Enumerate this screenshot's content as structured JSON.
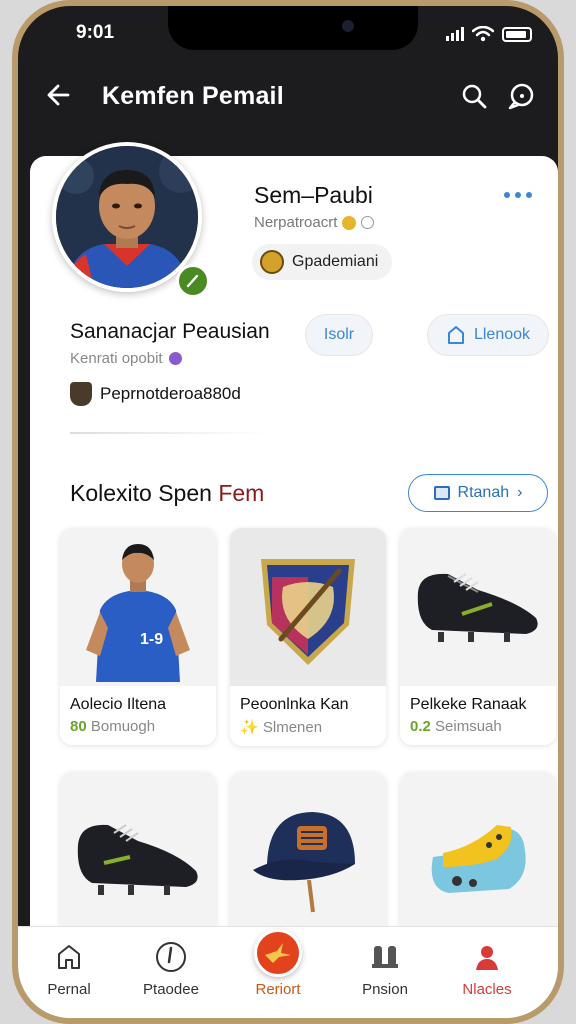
{
  "status_bar": {
    "time": "9:01"
  },
  "header": {
    "title": "Kemfen Pemail"
  },
  "profile": {
    "name": "Sem–Paubi",
    "subline": "Nerpatroacrt",
    "chip_label": "Gpademiani",
    "full_name": "Sananacjar Peausian",
    "sub2": "Kenrati opobit",
    "button_small": "Isolr",
    "button_large": "Llenook",
    "club": "Peprnotderoa880d"
  },
  "collection": {
    "title_prefix": "Kolexito Spen ",
    "title_highlight": "Fem",
    "view_all": "Rtanah",
    "items": [
      {
        "title": "Aolecio Iltena",
        "price": "80",
        "meta": "Bomuogh"
      },
      {
        "title": "Peoonlnka Kan",
        "price": "✨",
        "meta": "Slmenen"
      },
      {
        "title": "Pelkeke Ranaak",
        "price": "0.2",
        "meta": "Seimsuah"
      },
      {
        "title": "",
        "price": "",
        "meta": ""
      },
      {
        "title": "",
        "price": "",
        "meta": ""
      },
      {
        "title": "",
        "price": "",
        "meta": ""
      }
    ]
  },
  "nav": {
    "items": [
      {
        "label": "Pernal",
        "icon": "home-icon"
      },
      {
        "label": "Ptaodee",
        "icon": "compass-icon"
      },
      {
        "label": "Reriort",
        "icon": "bird-icon"
      },
      {
        "label": "Pnsion",
        "icon": "users-icon"
      },
      {
        "label": "Nlacles",
        "icon": "person-icon"
      }
    ]
  },
  "colors": {
    "accent": "#3a86d8",
    "brand_orange": "#e2431d",
    "success": "#6aa52a",
    "header_bg": "#1c1c1e"
  }
}
